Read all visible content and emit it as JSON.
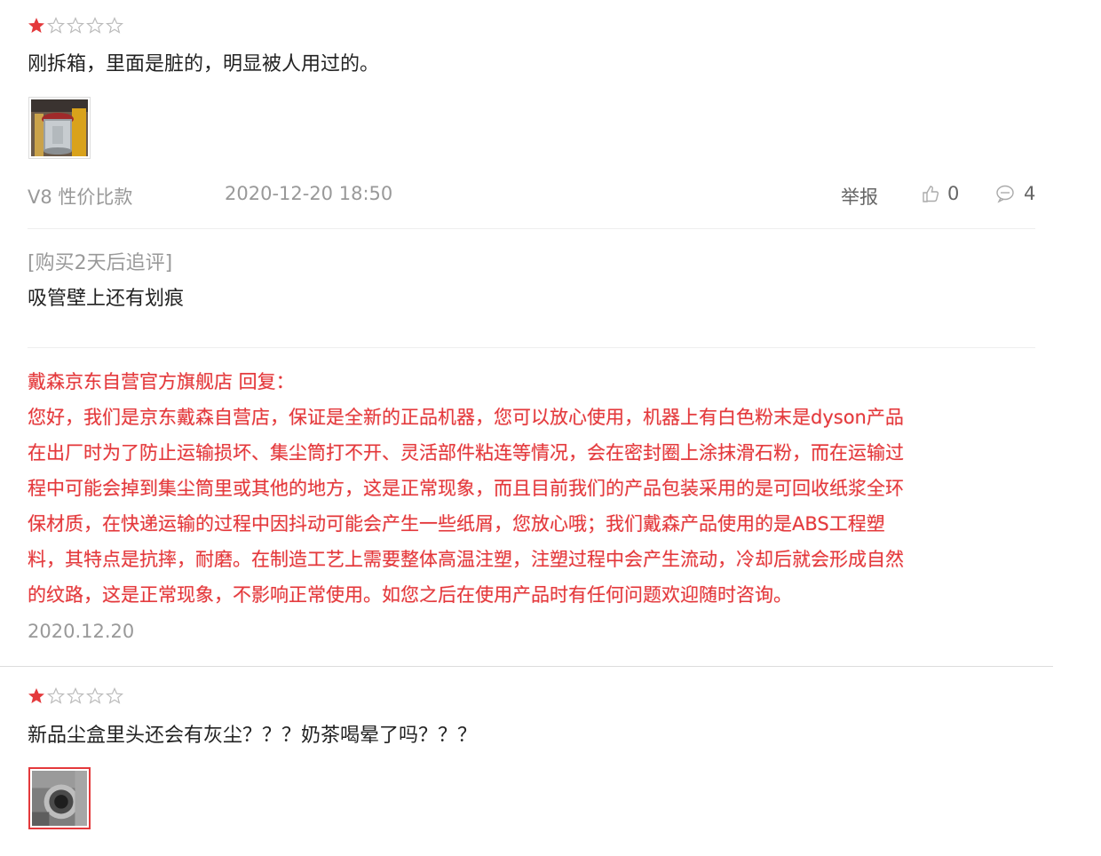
{
  "reviews": [
    {
      "rating": 1,
      "rating_max": 5,
      "content": "刚拆箱，里面是脏的，明显被人用过的。",
      "images": [
        {
          "alt": "vacuum-dustbin-photo"
        }
      ],
      "variant": "V8 性价比款",
      "date": "2020-12-20 18:50",
      "report_label": "举报",
      "likes": "0",
      "comments": "4",
      "followup": {
        "label": "[购买2天后追评]",
        "content": "吸管壁上还有划痕"
      },
      "reply": {
        "lines": [
          "戴森京东自营官方旗舰店 回复：",
          "您好，我们是京东戴森自营店，保证是全新的正品机器，您可以放心使用，机器上有白色粉末是dyson产品",
          "在出厂时为了防止运输损坏、集尘筒打不开、灵活部件粘连等情况，会在密封圈上涂抹滑石粉，而在运输过",
          "程中可能会掉到集尘筒里或其他的地方，这是正常现象，而且目前我们的产品包装采用的是可回收纸浆全环",
          "保材质，在快递运输的过程中因抖动可能会产生一些纸屑，您放心哦；我们戴森产品使用的是ABS工程塑",
          "料，其特点是抗摔，耐磨。在制造工艺上需要整体高温注塑，注塑过程中会产生流动，冷却后就会形成自然",
          "的纹路，这是正常现象，不影响正常使用。如您之后在使用产品时有任何问题欢迎随时咨询。"
        ],
        "date": "2020.12.20"
      }
    },
    {
      "rating": 1,
      "rating_max": 5,
      "content": "新品尘盒里头还会有灰尘？？？奶茶喝晕了吗？？？",
      "images": [
        {
          "alt": "dustbin-interior-photo"
        }
      ]
    }
  ],
  "colors": {
    "star_filled": "#e4393c",
    "star_empty": "#cccccc",
    "reply_text": "#e4393c",
    "muted_text": "#999999",
    "icons": [
      "thumbs-up-icon",
      "comment-icon",
      "star-icon"
    ]
  }
}
